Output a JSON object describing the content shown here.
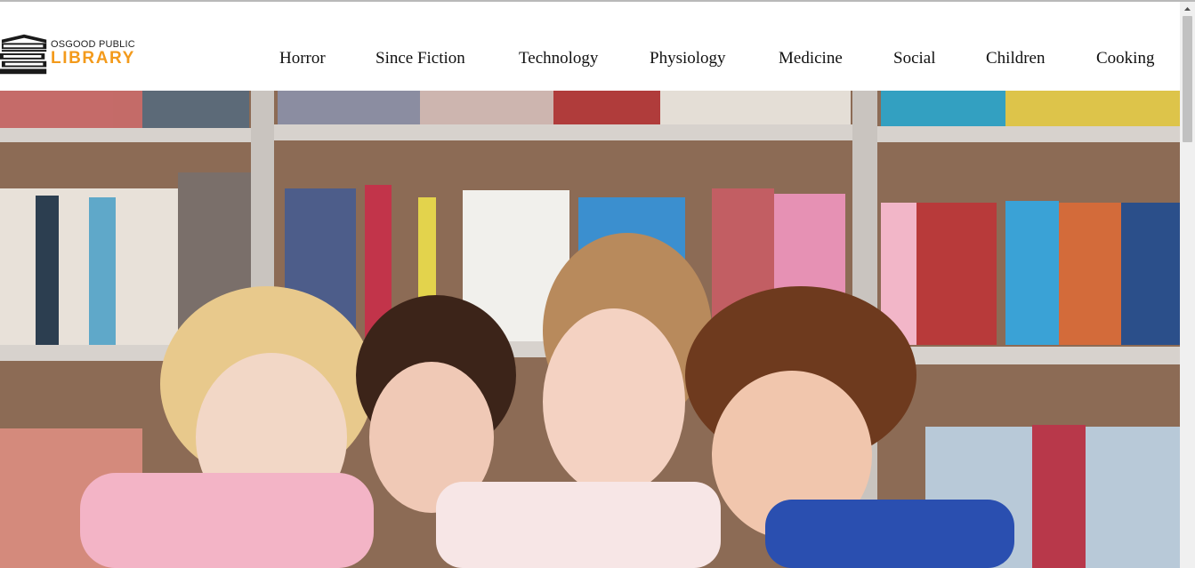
{
  "logo": {
    "line1": "OSGOOD PUBLIC",
    "line2": "LIBRARY",
    "icon": "stacked-books-icon",
    "accent_color": "#f39a1b"
  },
  "nav": {
    "items": [
      {
        "label": "Horror"
      },
      {
        "label": "Since Fiction"
      },
      {
        "label": "Technology"
      },
      {
        "label": "Physiology"
      },
      {
        "label": "Medicine"
      },
      {
        "label": "Social"
      },
      {
        "label": "Children"
      },
      {
        "label": "Cooking"
      }
    ]
  },
  "hero": {
    "subject": "teacher-and-children-reading-in-library-image"
  }
}
